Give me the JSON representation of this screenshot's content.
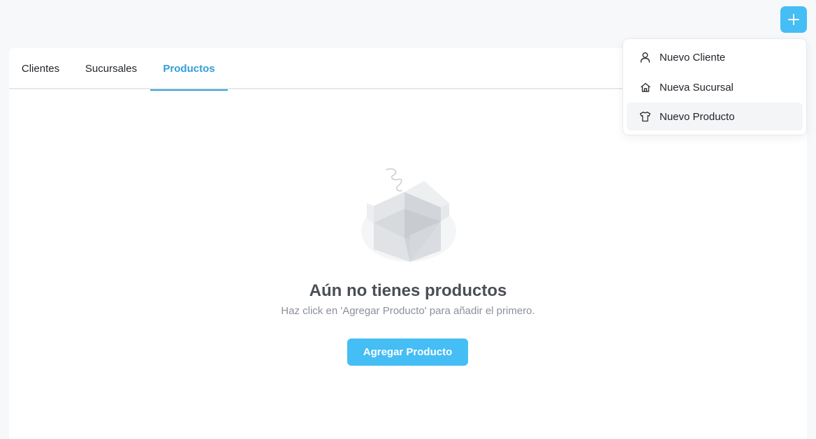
{
  "header": {
    "add_button_icon": "plus-icon",
    "accent_color": "#45bdf5"
  },
  "tabs": [
    {
      "label": "Clientes",
      "active": false
    },
    {
      "label": "Sucursales",
      "active": false
    },
    {
      "label": "Productos",
      "active": true
    }
  ],
  "empty_state": {
    "illustration": "empty-box-icon",
    "title": "Aún no tienes productos",
    "subtitle": "Haz click en 'Agregar Producto' para añadir el primero.",
    "button_label": "Agregar Producto"
  },
  "dropdown": {
    "items": [
      {
        "label": "Nuevo Cliente",
        "icon": "user-icon"
      },
      {
        "label": "Nueva Sucursal",
        "icon": "home-icon"
      },
      {
        "label": "Nuevo Producto",
        "icon": "shirt-icon",
        "highlighted": true
      }
    ]
  }
}
